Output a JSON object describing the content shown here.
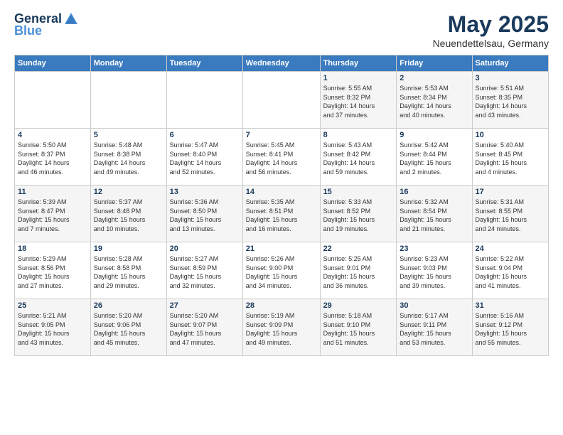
{
  "header": {
    "logo_line1": "General",
    "logo_line2": "Blue",
    "title": "May 2025",
    "subtitle": "Neuendettelsau, Germany"
  },
  "days_of_week": [
    "Sunday",
    "Monday",
    "Tuesday",
    "Wednesday",
    "Thursday",
    "Friday",
    "Saturday"
  ],
  "weeks": [
    [
      {
        "day": "",
        "info": ""
      },
      {
        "day": "",
        "info": ""
      },
      {
        "day": "",
        "info": ""
      },
      {
        "day": "",
        "info": ""
      },
      {
        "day": "1",
        "info": "Sunrise: 5:55 AM\nSunset: 8:32 PM\nDaylight: 14 hours\nand 37 minutes."
      },
      {
        "day": "2",
        "info": "Sunrise: 5:53 AM\nSunset: 8:34 PM\nDaylight: 14 hours\nand 40 minutes."
      },
      {
        "day": "3",
        "info": "Sunrise: 5:51 AM\nSunset: 8:35 PM\nDaylight: 14 hours\nand 43 minutes."
      }
    ],
    [
      {
        "day": "4",
        "info": "Sunrise: 5:50 AM\nSunset: 8:37 PM\nDaylight: 14 hours\nand 46 minutes."
      },
      {
        "day": "5",
        "info": "Sunrise: 5:48 AM\nSunset: 8:38 PM\nDaylight: 14 hours\nand 49 minutes."
      },
      {
        "day": "6",
        "info": "Sunrise: 5:47 AM\nSunset: 8:40 PM\nDaylight: 14 hours\nand 52 minutes."
      },
      {
        "day": "7",
        "info": "Sunrise: 5:45 AM\nSunset: 8:41 PM\nDaylight: 14 hours\nand 56 minutes."
      },
      {
        "day": "8",
        "info": "Sunrise: 5:43 AM\nSunset: 8:42 PM\nDaylight: 14 hours\nand 59 minutes."
      },
      {
        "day": "9",
        "info": "Sunrise: 5:42 AM\nSunset: 8:44 PM\nDaylight: 15 hours\nand 2 minutes."
      },
      {
        "day": "10",
        "info": "Sunrise: 5:40 AM\nSunset: 8:45 PM\nDaylight: 15 hours\nand 4 minutes."
      }
    ],
    [
      {
        "day": "11",
        "info": "Sunrise: 5:39 AM\nSunset: 8:47 PM\nDaylight: 15 hours\nand 7 minutes."
      },
      {
        "day": "12",
        "info": "Sunrise: 5:37 AM\nSunset: 8:48 PM\nDaylight: 15 hours\nand 10 minutes."
      },
      {
        "day": "13",
        "info": "Sunrise: 5:36 AM\nSunset: 8:50 PM\nDaylight: 15 hours\nand 13 minutes."
      },
      {
        "day": "14",
        "info": "Sunrise: 5:35 AM\nSunset: 8:51 PM\nDaylight: 15 hours\nand 16 minutes."
      },
      {
        "day": "15",
        "info": "Sunrise: 5:33 AM\nSunset: 8:52 PM\nDaylight: 15 hours\nand 19 minutes."
      },
      {
        "day": "16",
        "info": "Sunrise: 5:32 AM\nSunset: 8:54 PM\nDaylight: 15 hours\nand 21 minutes."
      },
      {
        "day": "17",
        "info": "Sunrise: 5:31 AM\nSunset: 8:55 PM\nDaylight: 15 hours\nand 24 minutes."
      }
    ],
    [
      {
        "day": "18",
        "info": "Sunrise: 5:29 AM\nSunset: 8:56 PM\nDaylight: 15 hours\nand 27 minutes."
      },
      {
        "day": "19",
        "info": "Sunrise: 5:28 AM\nSunset: 8:58 PM\nDaylight: 15 hours\nand 29 minutes."
      },
      {
        "day": "20",
        "info": "Sunrise: 5:27 AM\nSunset: 8:59 PM\nDaylight: 15 hours\nand 32 minutes."
      },
      {
        "day": "21",
        "info": "Sunrise: 5:26 AM\nSunset: 9:00 PM\nDaylight: 15 hours\nand 34 minutes."
      },
      {
        "day": "22",
        "info": "Sunrise: 5:25 AM\nSunset: 9:01 PM\nDaylight: 15 hours\nand 36 minutes."
      },
      {
        "day": "23",
        "info": "Sunrise: 5:23 AM\nSunset: 9:03 PM\nDaylight: 15 hours\nand 39 minutes."
      },
      {
        "day": "24",
        "info": "Sunrise: 5:22 AM\nSunset: 9:04 PM\nDaylight: 15 hours\nand 41 minutes."
      }
    ],
    [
      {
        "day": "25",
        "info": "Sunrise: 5:21 AM\nSunset: 9:05 PM\nDaylight: 15 hours\nand 43 minutes."
      },
      {
        "day": "26",
        "info": "Sunrise: 5:20 AM\nSunset: 9:06 PM\nDaylight: 15 hours\nand 45 minutes."
      },
      {
        "day": "27",
        "info": "Sunrise: 5:20 AM\nSunset: 9:07 PM\nDaylight: 15 hours\nand 47 minutes."
      },
      {
        "day": "28",
        "info": "Sunrise: 5:19 AM\nSunset: 9:09 PM\nDaylight: 15 hours\nand 49 minutes."
      },
      {
        "day": "29",
        "info": "Sunrise: 5:18 AM\nSunset: 9:10 PM\nDaylight: 15 hours\nand 51 minutes."
      },
      {
        "day": "30",
        "info": "Sunrise: 5:17 AM\nSunset: 9:11 PM\nDaylight: 15 hours\nand 53 minutes."
      },
      {
        "day": "31",
        "info": "Sunrise: 5:16 AM\nSunset: 9:12 PM\nDaylight: 15 hours\nand 55 minutes."
      }
    ]
  ]
}
